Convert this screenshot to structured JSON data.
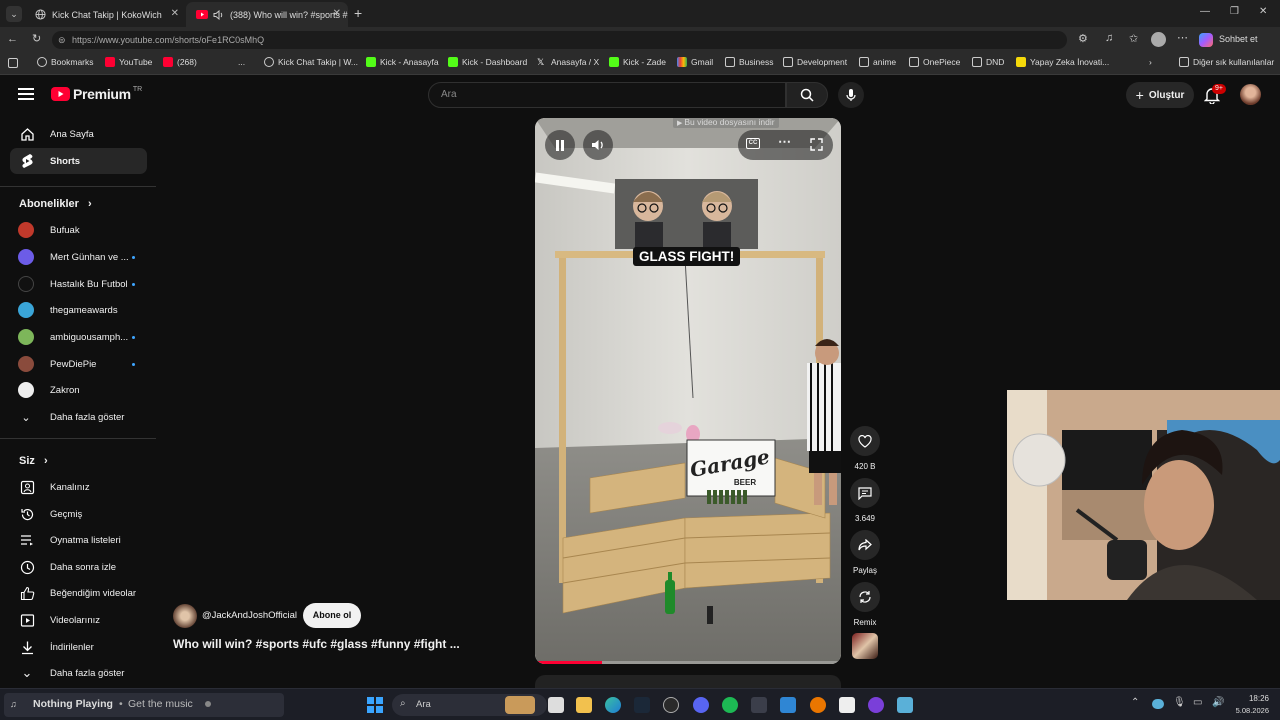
{
  "browser": {
    "tabs": [
      {
        "title": "Kick Chat Takip | KokoWich",
        "active": false
      },
      {
        "title": "(388) Who will win? #sports #",
        "active": true
      }
    ],
    "url": "https://www.youtube.com/shorts/oFe1RC0sMhQ",
    "chat_button": "Sohbet et",
    "bookmarks": [
      {
        "label": "Bookmarks"
      },
      {
        "label": "YouTube"
      },
      {
        "label": "(268)"
      },
      {
        "label": "..."
      },
      {
        "label": "Kick Chat Takip | W..."
      },
      {
        "label": "Kick - Anasayfa"
      },
      {
        "label": "Kick - Dashboard"
      },
      {
        "label": "Anasayfa / X"
      },
      {
        "label": "Kick - Zade"
      },
      {
        "label": "Gmail"
      },
      {
        "label": "Business"
      },
      {
        "label": "Development"
      },
      {
        "label": "anime"
      },
      {
        "label": "OnePiece"
      },
      {
        "label": "DND"
      },
      {
        "label": "Yapay Zeka İnovati..."
      },
      {
        "label": "Diğer sık kullanılanlar"
      }
    ]
  },
  "youtube": {
    "logo": "Premium",
    "logo_region": "TR",
    "search_placeholder": "Ara",
    "create_label": "Oluştur",
    "notif_count": "9+",
    "sidebar": {
      "main": [
        {
          "label": "Ana Sayfa",
          "icon": "home-icon",
          "selected": false
        },
        {
          "label": "Shorts",
          "icon": "shorts-icon",
          "selected": true
        }
      ],
      "subs_header": "Abonelikler",
      "subscriptions": [
        {
          "label": "Bufuak",
          "color": "#c0392b",
          "dot": false
        },
        {
          "label": "Mert Günhan ve ...",
          "color": "#6c5ce7",
          "dot": true
        },
        {
          "label": "Hastalık Bu Futbol",
          "color": "#111111",
          "dot": true
        },
        {
          "label": "thegameawards",
          "color": "#3aa5d8",
          "dot": false
        },
        {
          "label": "ambiguousamph...",
          "color": "#7db65a",
          "dot": true
        },
        {
          "label": "PewDiePie",
          "color": "#8a4b3c",
          "dot": true
        },
        {
          "label": "Zakron",
          "color": "#eeeeee",
          "dot": false
        }
      ],
      "show_more": "Daha fazla göster",
      "you_header": "Siz",
      "you_items": [
        {
          "label": "Kanalınız",
          "icon": "channel-icon"
        },
        {
          "label": "Geçmiş",
          "icon": "history-icon"
        },
        {
          "label": "Oynatma listeleri",
          "icon": "playlist-icon"
        },
        {
          "label": "Daha sonra izle",
          "icon": "clock-icon"
        },
        {
          "label": "Beğendiğim videolar",
          "icon": "thumb-up-icon"
        },
        {
          "label": "Videolarınız",
          "icon": "video-icon"
        },
        {
          "label": "İndirilenler",
          "icon": "download-icon"
        },
        {
          "label": "Daha fazla göster",
          "icon": "chevron-down-icon"
        }
      ]
    },
    "short": {
      "channel": "@JackAndJoshOfficial",
      "subscribe": "Abone ol",
      "title": "Who will win? #sports #ufc #glass #funny #fight ...",
      "overlay_text": "GLASS FIGHT!",
      "download_hint": "Bu video dosyasını indir",
      "sign_text_1": "Garage",
      "sign_text_2": "BEER",
      "progress": 0.22,
      "actions": [
        {
          "label": "420 B",
          "icon": "heart-icon"
        },
        {
          "label": "3.649",
          "icon": "comment-icon"
        },
        {
          "label": "Paylaş",
          "icon": "share-icon"
        },
        {
          "label": "Remix",
          "icon": "remix-icon"
        }
      ]
    }
  },
  "taskbar": {
    "now_playing": "Nothing Playing",
    "get_music": "Get the music",
    "search": "Ara",
    "time": "18:26",
    "date": "5.08.2026"
  },
  "colors": {
    "yt_red": "#ff0033",
    "page_bg": "#0f0f0f",
    "accent_blue": "#3ea6ff"
  }
}
